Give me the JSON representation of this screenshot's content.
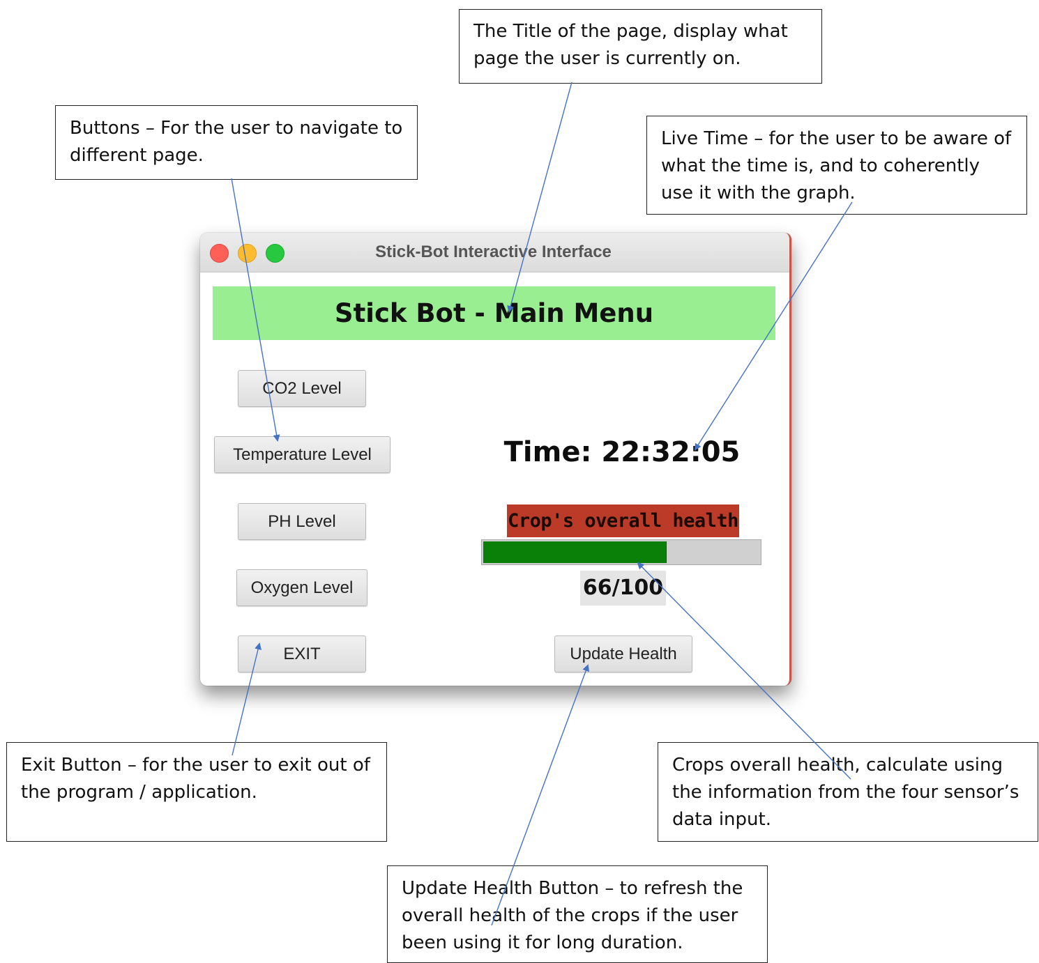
{
  "window": {
    "title": "Stick-Bot Interactive Interface"
  },
  "header": {
    "title": "Stick Bot - Main Menu"
  },
  "buttons": {
    "co2": "CO2 Level",
    "temperature": "Temperature Level",
    "ph": "PH Level",
    "oxygen": "Oxygen Level",
    "exit": "EXIT",
    "update_health": "Update Health"
  },
  "time": {
    "label": "Time: 22:32:05"
  },
  "health": {
    "label": "Crop's overall health",
    "value": 66,
    "max": 100,
    "score_text": "66/100",
    "bar_color": "#0a8008",
    "label_bg": "#bb3b28"
  },
  "banner_color": "#98ee90",
  "annotations": {
    "title": "The Title of the page, display what page the user is currently on.",
    "buttons": "Buttons – For the user to navigate to different page.",
    "live_time": "Live Time – for the user to be aware of what the time is, and to coherently use it with the graph.",
    "exit": "Exit Button – for the user to exit out of the program / application.",
    "crops_health": "Crops overall health, calculate using the information from the four sensor’s data input.",
    "update_health": "Update Health Button – to refresh the overall health of the crops if the user been using it for long duration."
  },
  "arrow_color": "#4472c4"
}
